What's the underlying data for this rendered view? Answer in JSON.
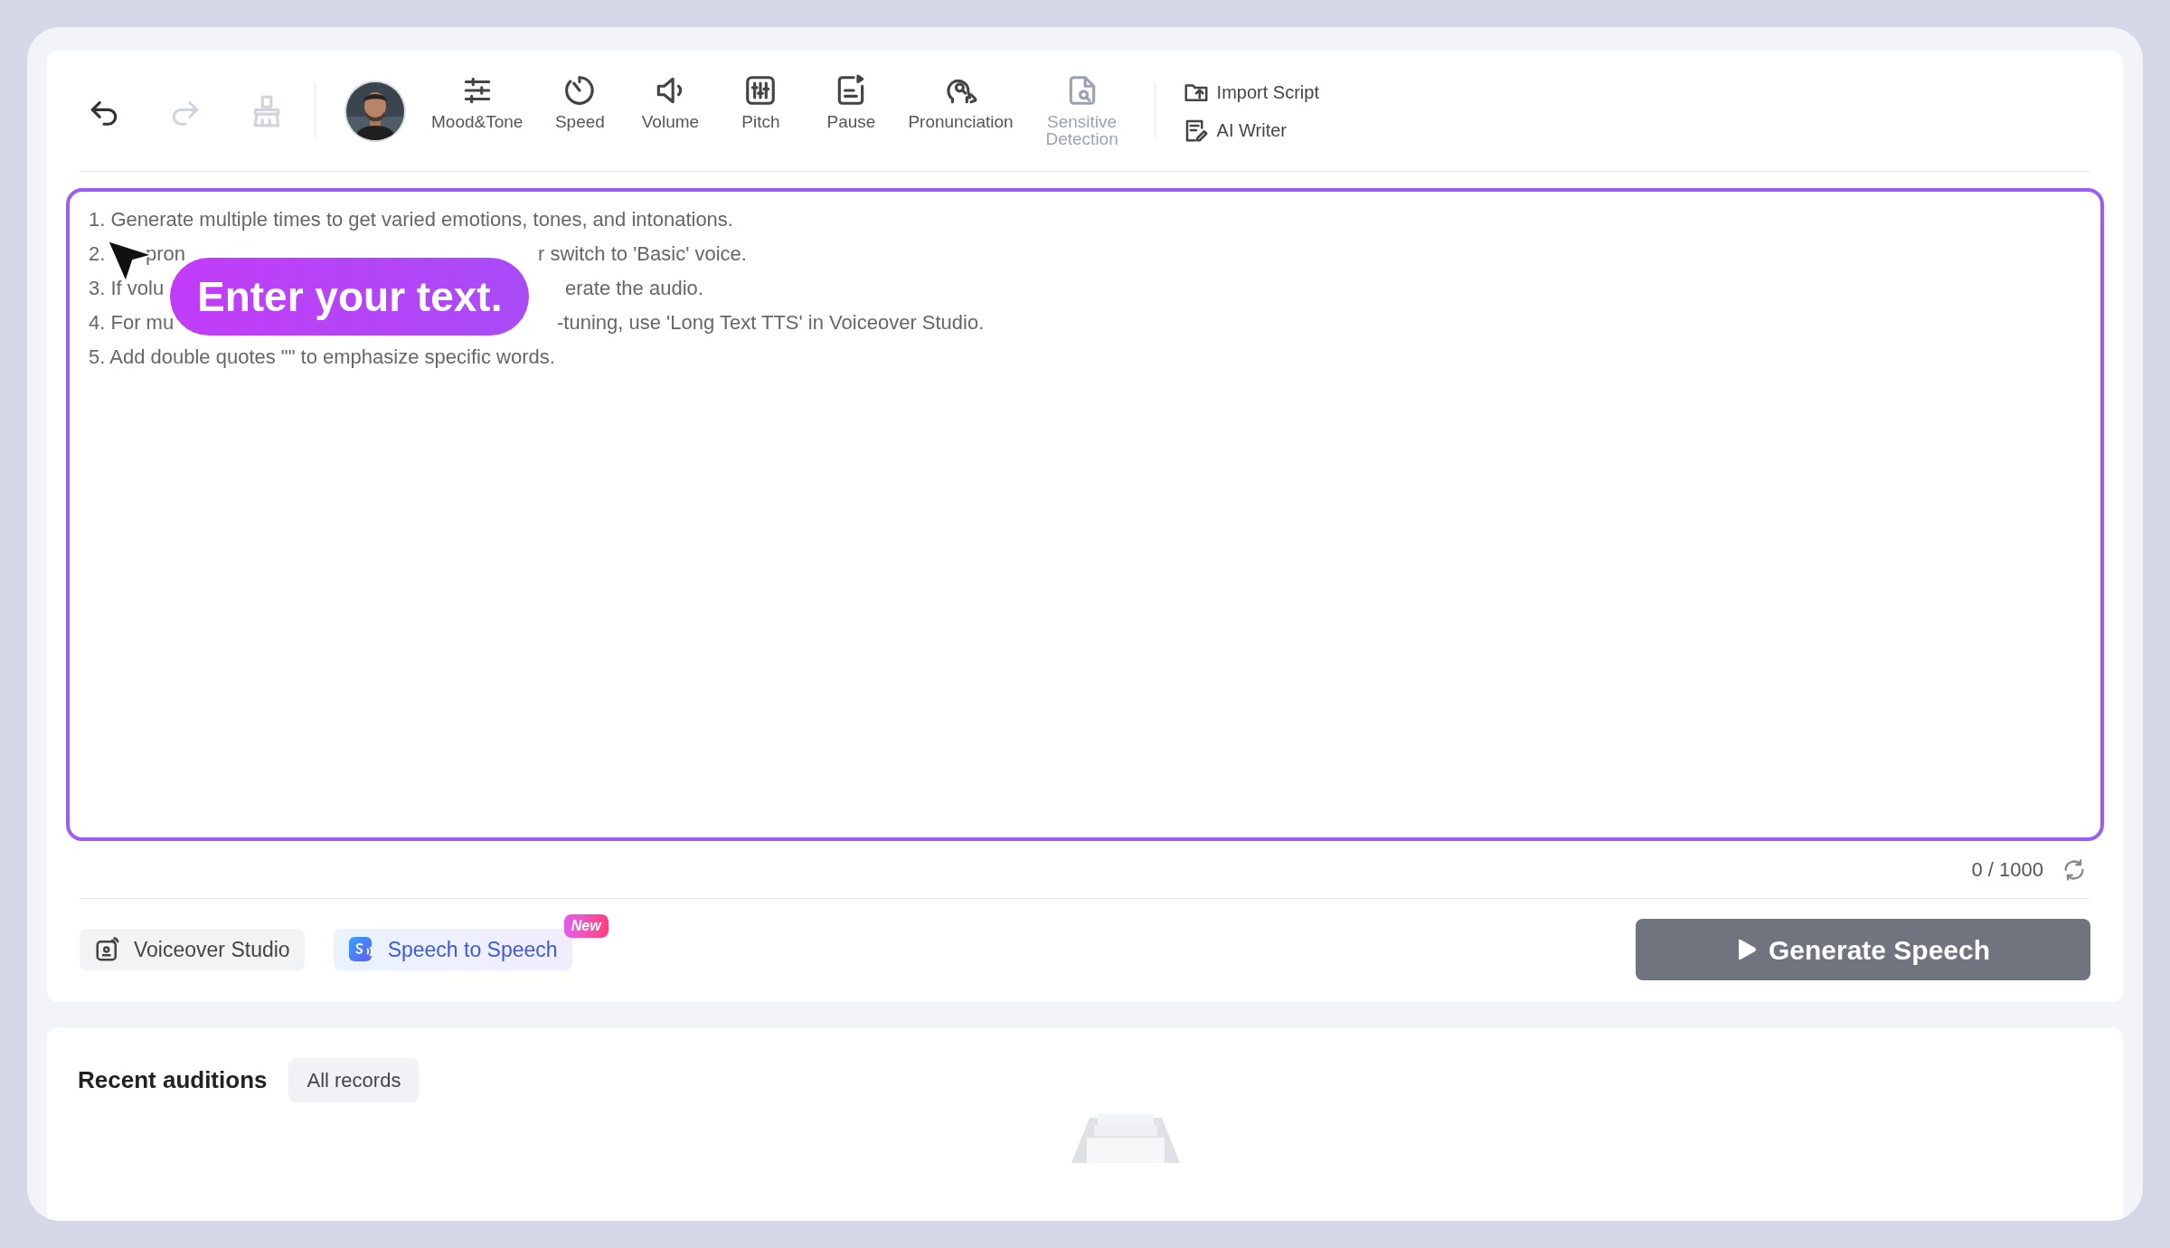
{
  "toolbar": {
    "history": [
      {
        "kind": "undo",
        "disabled": false
      },
      {
        "kind": "redo",
        "disabled": true
      },
      {
        "kind": "clear",
        "disabled": true
      }
    ],
    "tools": [
      {
        "label": "Mood&Tone",
        "kind": "mood",
        "disabled": false
      },
      {
        "label": "Speed",
        "kind": "speed",
        "disabled": false
      },
      {
        "label": "Volume",
        "kind": "volume",
        "disabled": false
      },
      {
        "label": "Pitch",
        "kind": "pitch",
        "disabled": false
      },
      {
        "label": "Pause",
        "kind": "pause",
        "disabled": false
      },
      {
        "label": "Pronunciation",
        "kind": "pronunciation",
        "disabled": false
      },
      {
        "label": "Sensitive Detection",
        "kind": "sensitive",
        "disabled": true
      }
    ],
    "actions": [
      {
        "label": "Import Script",
        "kind": "import"
      },
      {
        "label": "AI Writer",
        "kind": "writer"
      }
    ]
  },
  "editor": {
    "focused": true,
    "hint_lines": [
      {
        "parts": [
          "1. Generate multiple times to get varied emotions, tones, and intonations."
        ]
      },
      {
        "parts": [
          "2.",
          "pron",
          "r switch to 'Basic' voice."
        ]
      },
      {
        "parts": [
          "3. If volu",
          "erate the audio."
        ]
      },
      {
        "parts": [
          "4. For mu",
          "-tuning, use 'Long Text TTS' in Voiceover Studio."
        ]
      },
      {
        "parts": [
          "5. Add double quotes \"\" to emphasize specific words."
        ]
      }
    ],
    "tooltip": "Enter your text.",
    "counter": "0 / 1000"
  },
  "modes": [
    {
      "label": "Voiceover Studio",
      "kind": "studio",
      "selected": false
    },
    {
      "label": "Speech to Speech",
      "kind": "s2s",
      "selected": true,
      "badge": "New"
    }
  ],
  "generate_button": {
    "label": "Generate Speech",
    "disabled": true
  },
  "recent": {
    "title": "Recent auditions",
    "filter": "All records"
  }
}
